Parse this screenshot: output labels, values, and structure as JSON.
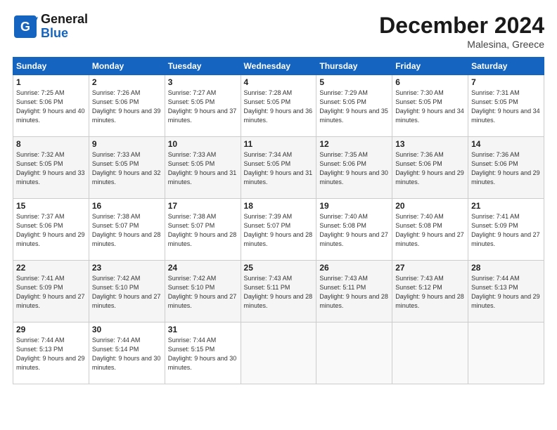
{
  "header": {
    "logo_line1": "General",
    "logo_line2": "Blue",
    "month_title": "December 2024",
    "location": "Malesina, Greece"
  },
  "weekdays": [
    "Sunday",
    "Monday",
    "Tuesday",
    "Wednesday",
    "Thursday",
    "Friday",
    "Saturday"
  ],
  "weeks": [
    [
      {
        "day": "1",
        "sunrise": "Sunrise: 7:25 AM",
        "sunset": "Sunset: 5:06 PM",
        "daylight": "Daylight: 9 hours and 40 minutes."
      },
      {
        "day": "2",
        "sunrise": "Sunrise: 7:26 AM",
        "sunset": "Sunset: 5:06 PM",
        "daylight": "Daylight: 9 hours and 39 minutes."
      },
      {
        "day": "3",
        "sunrise": "Sunrise: 7:27 AM",
        "sunset": "Sunset: 5:05 PM",
        "daylight": "Daylight: 9 hours and 37 minutes."
      },
      {
        "day": "4",
        "sunrise": "Sunrise: 7:28 AM",
        "sunset": "Sunset: 5:05 PM",
        "daylight": "Daylight: 9 hours and 36 minutes."
      },
      {
        "day": "5",
        "sunrise": "Sunrise: 7:29 AM",
        "sunset": "Sunset: 5:05 PM",
        "daylight": "Daylight: 9 hours and 35 minutes."
      },
      {
        "day": "6",
        "sunrise": "Sunrise: 7:30 AM",
        "sunset": "Sunset: 5:05 PM",
        "daylight": "Daylight: 9 hours and 34 minutes."
      },
      {
        "day": "7",
        "sunrise": "Sunrise: 7:31 AM",
        "sunset": "Sunset: 5:05 PM",
        "daylight": "Daylight: 9 hours and 34 minutes."
      }
    ],
    [
      {
        "day": "8",
        "sunrise": "Sunrise: 7:32 AM",
        "sunset": "Sunset: 5:05 PM",
        "daylight": "Daylight: 9 hours and 33 minutes."
      },
      {
        "day": "9",
        "sunrise": "Sunrise: 7:33 AM",
        "sunset": "Sunset: 5:05 PM",
        "daylight": "Daylight: 9 hours and 32 minutes."
      },
      {
        "day": "10",
        "sunrise": "Sunrise: 7:33 AM",
        "sunset": "Sunset: 5:05 PM",
        "daylight": "Daylight: 9 hours and 31 minutes."
      },
      {
        "day": "11",
        "sunrise": "Sunrise: 7:34 AM",
        "sunset": "Sunset: 5:05 PM",
        "daylight": "Daylight: 9 hours and 31 minutes."
      },
      {
        "day": "12",
        "sunrise": "Sunrise: 7:35 AM",
        "sunset": "Sunset: 5:06 PM",
        "daylight": "Daylight: 9 hours and 30 minutes."
      },
      {
        "day": "13",
        "sunrise": "Sunrise: 7:36 AM",
        "sunset": "Sunset: 5:06 PM",
        "daylight": "Daylight: 9 hours and 29 minutes."
      },
      {
        "day": "14",
        "sunrise": "Sunrise: 7:36 AM",
        "sunset": "Sunset: 5:06 PM",
        "daylight": "Daylight: 9 hours and 29 minutes."
      }
    ],
    [
      {
        "day": "15",
        "sunrise": "Sunrise: 7:37 AM",
        "sunset": "Sunset: 5:06 PM",
        "daylight": "Daylight: 9 hours and 29 minutes."
      },
      {
        "day": "16",
        "sunrise": "Sunrise: 7:38 AM",
        "sunset": "Sunset: 5:07 PM",
        "daylight": "Daylight: 9 hours and 28 minutes."
      },
      {
        "day": "17",
        "sunrise": "Sunrise: 7:38 AM",
        "sunset": "Sunset: 5:07 PM",
        "daylight": "Daylight: 9 hours and 28 minutes."
      },
      {
        "day": "18",
        "sunrise": "Sunrise: 7:39 AM",
        "sunset": "Sunset: 5:07 PM",
        "daylight": "Daylight: 9 hours and 28 minutes."
      },
      {
        "day": "19",
        "sunrise": "Sunrise: 7:40 AM",
        "sunset": "Sunset: 5:08 PM",
        "daylight": "Daylight: 9 hours and 27 minutes."
      },
      {
        "day": "20",
        "sunrise": "Sunrise: 7:40 AM",
        "sunset": "Sunset: 5:08 PM",
        "daylight": "Daylight: 9 hours and 27 minutes."
      },
      {
        "day": "21",
        "sunrise": "Sunrise: 7:41 AM",
        "sunset": "Sunset: 5:09 PM",
        "daylight": "Daylight: 9 hours and 27 minutes."
      }
    ],
    [
      {
        "day": "22",
        "sunrise": "Sunrise: 7:41 AM",
        "sunset": "Sunset: 5:09 PM",
        "daylight": "Daylight: 9 hours and 27 minutes."
      },
      {
        "day": "23",
        "sunrise": "Sunrise: 7:42 AM",
        "sunset": "Sunset: 5:10 PM",
        "daylight": "Daylight: 9 hours and 27 minutes."
      },
      {
        "day": "24",
        "sunrise": "Sunrise: 7:42 AM",
        "sunset": "Sunset: 5:10 PM",
        "daylight": "Daylight: 9 hours and 27 minutes."
      },
      {
        "day": "25",
        "sunrise": "Sunrise: 7:43 AM",
        "sunset": "Sunset: 5:11 PM",
        "daylight": "Daylight: 9 hours and 28 minutes."
      },
      {
        "day": "26",
        "sunrise": "Sunrise: 7:43 AM",
        "sunset": "Sunset: 5:11 PM",
        "daylight": "Daylight: 9 hours and 28 minutes."
      },
      {
        "day": "27",
        "sunrise": "Sunrise: 7:43 AM",
        "sunset": "Sunset: 5:12 PM",
        "daylight": "Daylight: 9 hours and 28 minutes."
      },
      {
        "day": "28",
        "sunrise": "Sunrise: 7:44 AM",
        "sunset": "Sunset: 5:13 PM",
        "daylight": "Daylight: 9 hours and 29 minutes."
      }
    ],
    [
      {
        "day": "29",
        "sunrise": "Sunrise: 7:44 AM",
        "sunset": "Sunset: 5:13 PM",
        "daylight": "Daylight: 9 hours and 29 minutes."
      },
      {
        "day": "30",
        "sunrise": "Sunrise: 7:44 AM",
        "sunset": "Sunset: 5:14 PM",
        "daylight": "Daylight: 9 hours and 30 minutes."
      },
      {
        "day": "31",
        "sunrise": "Sunrise: 7:44 AM",
        "sunset": "Sunset: 5:15 PM",
        "daylight": "Daylight: 9 hours and 30 minutes."
      },
      null,
      null,
      null,
      null
    ]
  ]
}
